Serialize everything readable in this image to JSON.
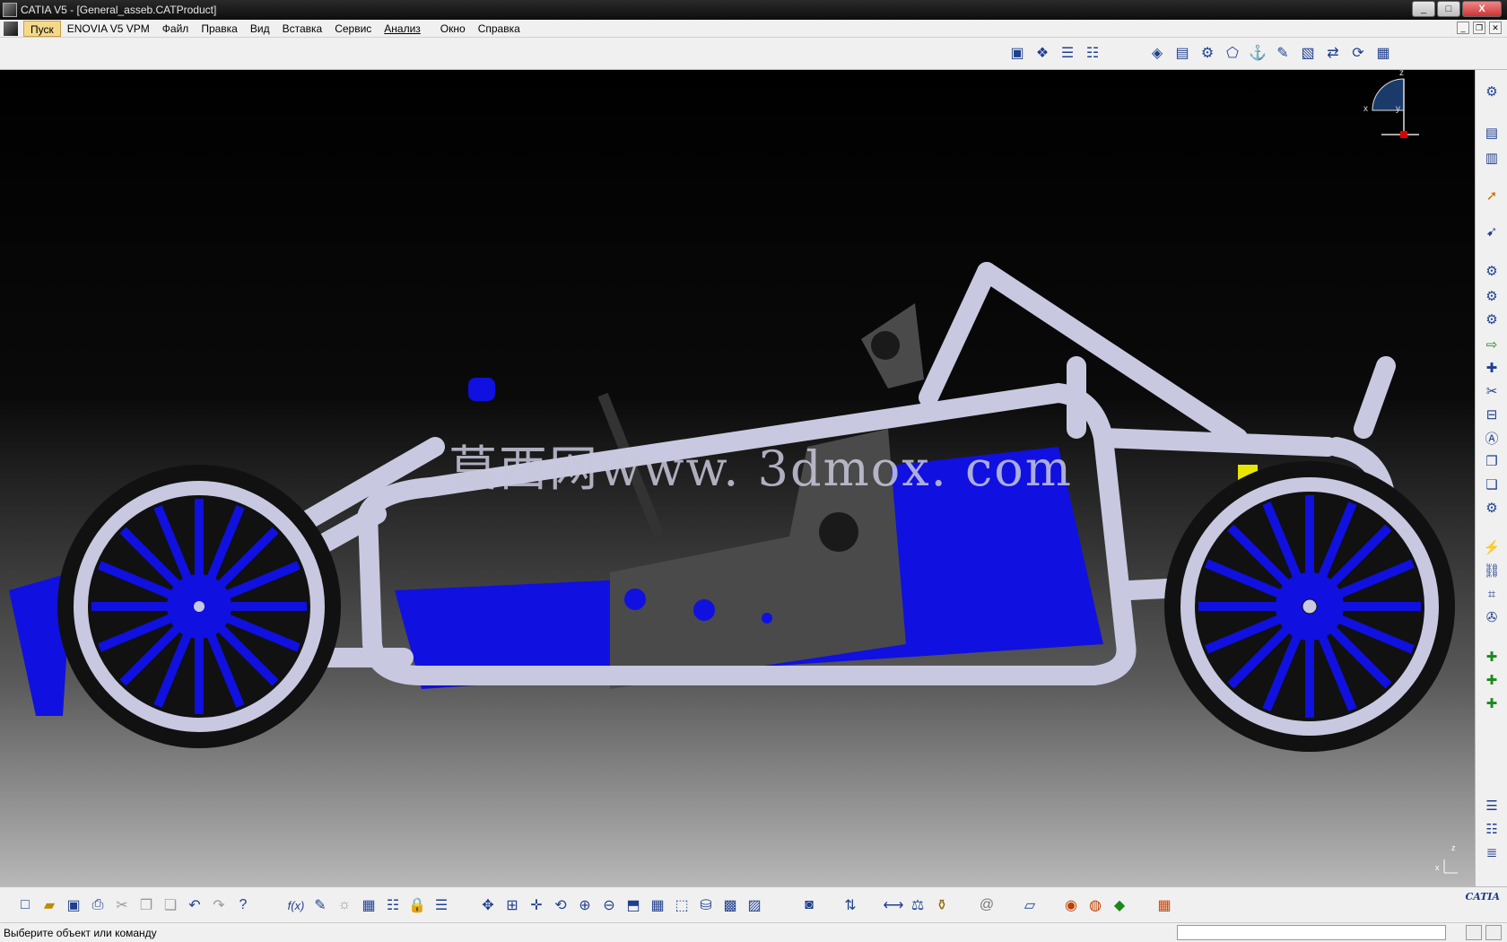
{
  "window": {
    "title": "CATIA V5 - [General_asseb.CATProduct]",
    "minimize": "_",
    "maximize": "□",
    "close": "X"
  },
  "menubar": {
    "items": [
      "Пуск",
      "ENOVIA V5 VPM",
      "Файл",
      "Правка",
      "Вид",
      "Вставка",
      "Сервис",
      "Анализ",
      "Окно",
      "Справка"
    ],
    "active_index": 0
  },
  "top_toolbar": {
    "group1": [
      "assembly-icon",
      "manipulate-icon",
      "tree-icon",
      "tree2-icon"
    ],
    "group2": [
      "knowledge-icon",
      "box-icon",
      "joints-icon",
      "shape-icon",
      "fix-icon",
      "pen-icon",
      "snapshot-icon",
      "flow-icon",
      "refresh-icon",
      "grid-icon"
    ]
  },
  "viewport": {
    "watermark": "莫西网www. 3dmox. com",
    "compass_labels": {
      "x": "x",
      "y": "y",
      "z": "z"
    },
    "axis_labels": {
      "x": "x",
      "z": "z"
    },
    "colors": {
      "frame": "#c8c8e0",
      "body": "#1010e0",
      "seat": "#4a4a4a",
      "shock": "#e6e600",
      "tire": "#111111"
    }
  },
  "right_toolbar": {
    "icons": [
      "settings-icon",
      "doc-icon",
      "doc2-icon",
      "cursor-icon",
      "cursor2-icon",
      "gear-icon",
      "gear2-icon",
      "gear3-icon",
      "export-icon",
      "insert-icon",
      "cut-icon",
      "constraint-icon",
      "ab-icon",
      "copy-icon",
      "paste-icon",
      "gear4-icon",
      "bolt-icon",
      "chain-icon",
      "bracket-icon",
      "wrench-icon",
      "add-icon",
      "add2-icon",
      "add3-icon",
      "tree3-icon",
      "tree4-icon",
      "list-icon"
    ]
  },
  "bottom_toolbar": {
    "icons": [
      "new-icon",
      "open-icon",
      "save-icon",
      "print-icon",
      "cut-icon",
      "copy-icon",
      "paste-icon",
      "undo-icon",
      "redo-icon",
      "help-icon",
      "formula-icon",
      "comment-icon",
      "bulb-icon",
      "table-icon",
      "tree-icon",
      "lock-icon",
      "filter-icon",
      "fit-icon",
      "center-icon",
      "pan-icon",
      "rotate-icon",
      "zoom-in-icon",
      "zoom-out-icon",
      "normal-icon",
      "views-icon",
      "cube-icon",
      "cylinder-icon",
      "render-icon",
      "image-icon",
      "camera-icon",
      "swap-icon",
      "measure-icon",
      "inertia-icon",
      "bottle-icon",
      "swirl-icon",
      "book-icon",
      "globe-icon",
      "palette-icon",
      "shapes-icon",
      "grid-icon"
    ],
    "logo": "CATIA"
  },
  "statusbar": {
    "message": "Выберите объект или команду",
    "command_value": ""
  }
}
